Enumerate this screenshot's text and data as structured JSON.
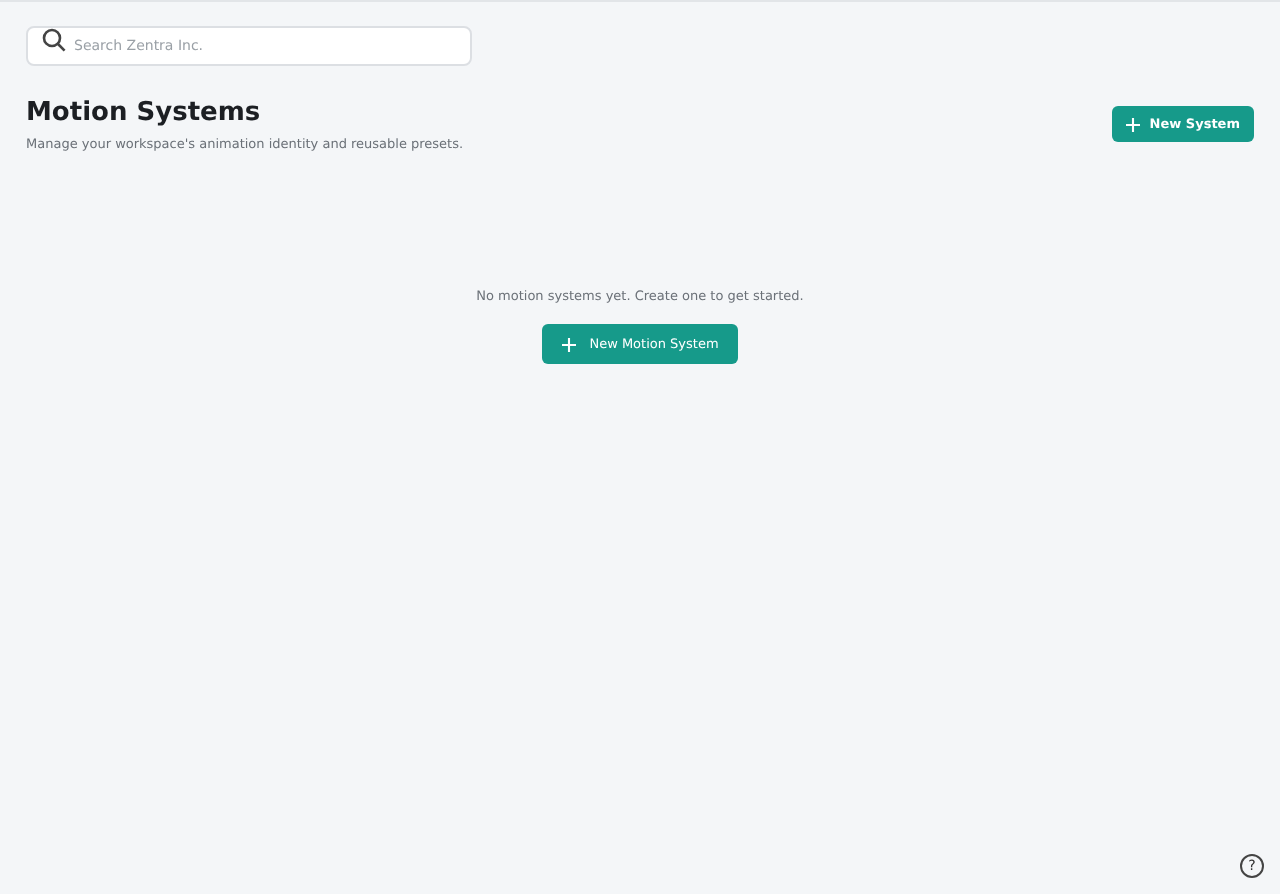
{
  "search": {
    "placeholder": "Search Zentra Inc."
  },
  "header": {
    "title": "Motion Systems",
    "subtitle": "Manage your workspace's animation identity and reusable presets.",
    "button": "New System"
  },
  "empty_state": {
    "message": "No motion systems yet. Create one to get started.",
    "button": "New Motion System"
  },
  "help_button": {
    "label": "?"
  }
}
